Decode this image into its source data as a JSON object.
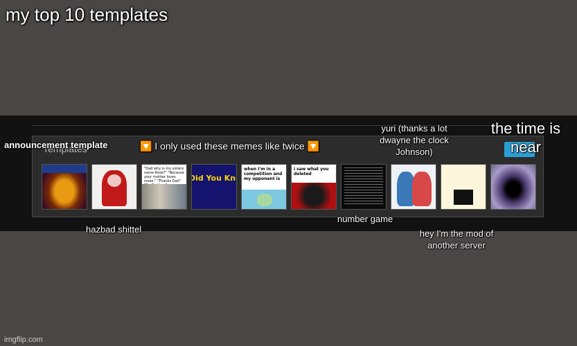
{
  "title": "my top 10 templates",
  "panel": {
    "heading": "Templates",
    "thumbnails": [
      {
        "name": "thumbnail-corn",
        "caption": ""
      },
      {
        "name": "thumbnail-red-character",
        "caption": ""
      },
      {
        "name": "thumbnail-text-photo",
        "caption": "\"Dad why is my sisters name Rose?\" \"Because your mother loves roses.\" \"Thanks Dad\" \"No Problem\""
      },
      {
        "name": "thumbnail-did-you-know",
        "caption": "Did You Know That"
      },
      {
        "name": "thumbnail-competition",
        "caption": "when I'm in a competition and my opponent is"
      },
      {
        "name": "thumbnail-i-saw-what-you-deleted",
        "caption": "i saw what you deleted"
      },
      {
        "name": "thumbnail-number-game",
        "caption": ""
      },
      {
        "name": "thumbnail-yuri",
        "caption": ""
      },
      {
        "name": "thumbnail-clock",
        "caption": ""
      },
      {
        "name": "thumbnail-black-hole",
        "caption": ""
      }
    ]
  },
  "labels": {
    "announcement": "announcement template",
    "used_twice": "🔽 I only used these memes like twice 🔽",
    "yuri": "yuri (thanks a lot dwayne the clock Johnson)",
    "time_near": "the time is near",
    "hazbad": "hazbad shittel",
    "number_game": "number game",
    "mod": "hey I'm the mod of another server"
  },
  "watermark": "imgflip.com"
}
